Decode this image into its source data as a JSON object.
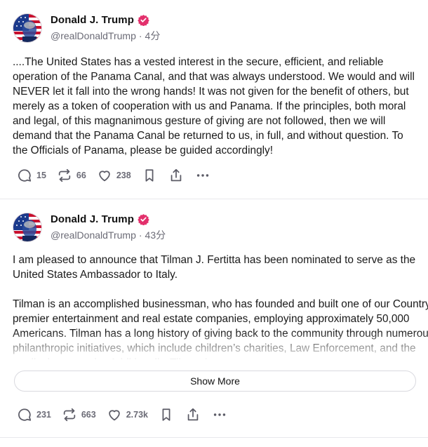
{
  "colors": {
    "verified_badge": "#e3306c",
    "icon_gray": "#5b5b66",
    "meta_gray": "#6b6b76",
    "divider": "#e8e8ec"
  },
  "posts": [
    {
      "author": {
        "display_name": "Donald J. Trump",
        "handle": "@realDonaldTrump",
        "separator": "·",
        "time": "4分",
        "verified_icon": "verified-badge-icon",
        "avatar_icon": "flag-portrait-avatar"
      },
      "paragraphs": [
        "....The United States has a vested interest in the secure, efficient, and reliable operation of the Panama Canal, and that was always understood. We would and will NEVER let it fall into the wrong hands! It was not given for the benefit of others, but merely as a token of cooperation with us and Panama. If the principles, both moral and legal, of this magnanimous gesture of giving are not followed, then we will demand that the Panama Canal be returned to us, in full, and without question. To the Officials of Panama, please be guided accordingly!"
      ],
      "actions": {
        "reply_count": "15",
        "retruth_count": "66",
        "like_count": "238",
        "reply_icon": "comment-icon",
        "retruth_icon": "repost-icon",
        "like_icon": "heart-icon",
        "bookmark_icon": "bookmark-icon",
        "share_icon": "share-icon",
        "more_icon": "more-dots-icon"
      }
    },
    {
      "author": {
        "display_name": "Donald J. Trump",
        "handle": "@realDonaldTrump",
        "separator": "·",
        "time": "43分",
        "verified_icon": "verified-badge-icon",
        "avatar_icon": "flag-portrait-avatar"
      },
      "paragraphs": [
        "I am pleased to announce that Tilman J. Fertitta has been nominated to serve as the United States Ambassador to Italy.",
        "Tilman is an accomplished businessman, who has founded and built one of our Country’s premier entertainment and real estate companies, employing approximately 50,000 Americans. Tilman has a long history of giving back to the community through numerous philanthropic initiatives, which include children’s charities, Law Enforcement, and the medical community. Additionally, Tilman is"
      ],
      "show_more_label": "Show More",
      "actions": {
        "reply_count": "231",
        "retruth_count": "663",
        "like_count": "2.73k",
        "reply_icon": "comment-icon",
        "retruth_icon": "repost-icon",
        "like_icon": "heart-icon",
        "bookmark_icon": "bookmark-icon",
        "share_icon": "share-icon",
        "more_icon": "more-dots-icon"
      }
    }
  ]
}
